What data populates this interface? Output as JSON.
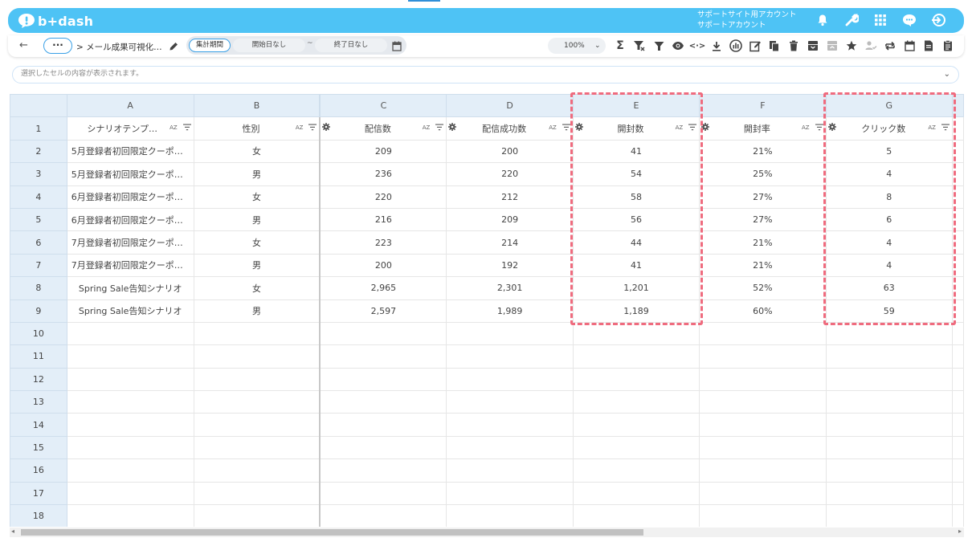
{
  "app": {
    "name": "b+dash"
  },
  "header": {
    "account_line1": "サポートサイト用アカウント",
    "account_line2": "サポートアカウント"
  },
  "toolbar": {
    "breadcrumb": "> メール成果可視化…",
    "period_button": "集計期間",
    "start_date": "開始日なし",
    "tilde": "~",
    "end_date": "終了日なし",
    "zoom": "100%"
  },
  "formula_bar": {
    "text": "選択したセルの内容が表示されます。"
  },
  "sheet": {
    "columns": [
      "A",
      "B",
      "C",
      "D",
      "E",
      "F",
      "G"
    ],
    "field_headers": [
      "シナリオテンプ…",
      "性別",
      "配信数",
      "配信成功数",
      "開封数",
      "開封率",
      "クリック数"
    ],
    "sort_label": "AZ",
    "rows": [
      {
        "num": "1"
      },
      {
        "num": "2",
        "cells": [
          "5月登録者初回限定クーポ…",
          "女",
          "209",
          "200",
          "41",
          "21%",
          "5"
        ]
      },
      {
        "num": "3",
        "cells": [
          "5月登録者初回限定クーポ…",
          "男",
          "236",
          "220",
          "54",
          "25%",
          "4"
        ]
      },
      {
        "num": "4",
        "cells": [
          "6月登録者初回限定クーポ…",
          "女",
          "220",
          "212",
          "58",
          "27%",
          "8"
        ]
      },
      {
        "num": "5",
        "cells": [
          "6月登録者初回限定クーポ…",
          "男",
          "216",
          "209",
          "56",
          "27%",
          "6"
        ]
      },
      {
        "num": "6",
        "cells": [
          "7月登録者初回限定クーポ…",
          "女",
          "223",
          "214",
          "44",
          "21%",
          "4"
        ]
      },
      {
        "num": "7",
        "cells": [
          "7月登録者初回限定クーポ…",
          "男",
          "200",
          "192",
          "41",
          "21%",
          "4"
        ]
      },
      {
        "num": "8",
        "cells": [
          "Spring Sale告知シナリオ",
          "女",
          "2,965",
          "2,301",
          "1,201",
          "52%",
          "63"
        ]
      },
      {
        "num": "9",
        "cells": [
          "Spring Sale告知シナリオ",
          "男",
          "2,597",
          "1,989",
          "1,189",
          "60%",
          "59"
        ]
      },
      {
        "num": "10"
      },
      {
        "num": "11"
      },
      {
        "num": "12"
      },
      {
        "num": "13"
      },
      {
        "num": "14"
      },
      {
        "num": "15"
      },
      {
        "num": "16"
      },
      {
        "num": "17"
      },
      {
        "num": "18"
      }
    ]
  },
  "colors": {
    "header_bg": "#4ec3f5",
    "accent": "#3aa0e6",
    "highlight": "#ef6b7e",
    "header_cell_bg": "#e3eef8"
  }
}
